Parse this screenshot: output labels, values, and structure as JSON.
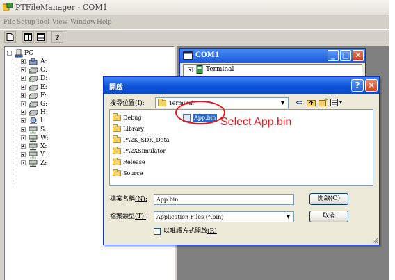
{
  "app": {
    "title": "PTFileManager - COM1",
    "menu": [
      "File",
      "Setup",
      "Tool",
      "View",
      "Window",
      "Help"
    ]
  },
  "tree": {
    "root": "PC",
    "drives": [
      "A:",
      "C:",
      "D:",
      "E:",
      "F:",
      "G:",
      "H:",
      "I:",
      "S:",
      "W:",
      "X:",
      "Y:",
      "Z:"
    ]
  },
  "mdi": {
    "title": "COM1",
    "tree_item": "Terminal"
  },
  "dialog": {
    "title": "開啟",
    "help_glyph": "?",
    "close_glyph": "✕",
    "look_in_label": "搜尋位置",
    "look_in_key": "(I):",
    "look_in_value": "Terminal",
    "files": [
      {
        "name": "Debug",
        "type": "folder"
      },
      {
        "name": "Library",
        "type": "folder"
      },
      {
        "name": "PA2K_SDK_Data",
        "type": "folder"
      },
      {
        "name": "PA2XSimulator",
        "type": "folder"
      },
      {
        "name": "Release",
        "type": "folder"
      },
      {
        "name": "Source",
        "type": "folder"
      },
      {
        "name": "App.bin",
        "type": "file",
        "selected": true
      }
    ],
    "annotation": "Select App.bin",
    "annotation_color": "#e8141a",
    "filename_label": "檔案名稱",
    "filename_key": "(N):",
    "filename_value": "App.bin",
    "filetype_label": "檔案類型",
    "filetype_key": "(T):",
    "filetype_value": "Application Files (*.bin)",
    "readonly_label": "以唯讀方式開啟",
    "readonly_key": "(R)",
    "readonly_checked": false,
    "open_button": "開啟",
    "open_button_key": "(O)",
    "cancel_button": "取消"
  },
  "colors": {
    "titlebar_blue": "#0a4fd6",
    "selection": "#316ac5",
    "workspace": "#808080"
  }
}
